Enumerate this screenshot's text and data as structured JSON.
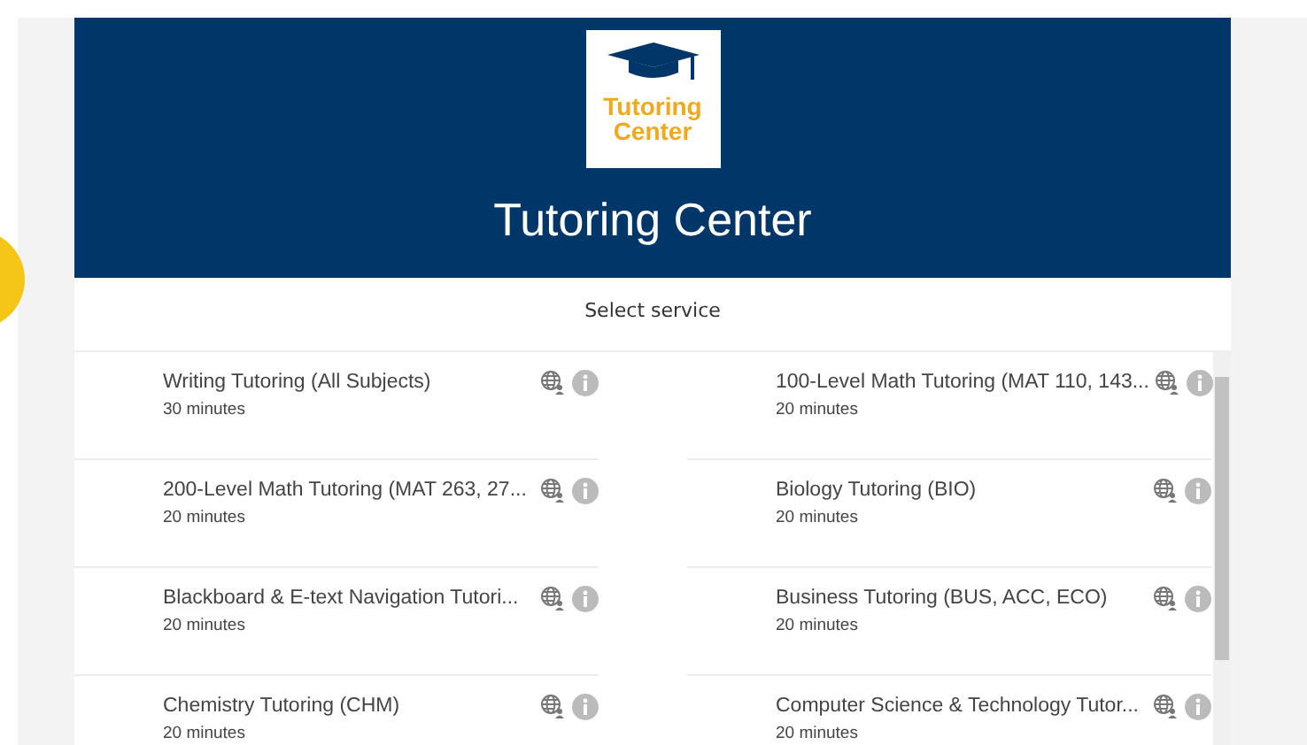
{
  "header": {
    "logo_lines": [
      "Tutoring",
      "Center"
    ],
    "title": "Tutoring Center"
  },
  "section_title": "Select service",
  "services": [
    {
      "name": "Writing Tutoring (All Subjects)",
      "duration": "30 minutes"
    },
    {
      "name": "100-Level Math Tutoring (MAT 110, 143...",
      "duration": "20 minutes"
    },
    {
      "name": "200-Level Math Tutoring (MAT 263, 27...",
      "duration": "20 minutes"
    },
    {
      "name": "Biology Tutoring (BIO)",
      "duration": "20 minutes"
    },
    {
      "name": "Blackboard & E-text Navigation Tutori...",
      "duration": "20 minutes"
    },
    {
      "name": "Business Tutoring (BUS, ACC, ECO)",
      "duration": "20 minutes"
    },
    {
      "name": "Chemistry Tutoring (CHM)",
      "duration": "20 minutes"
    },
    {
      "name": "Computer Science & Technology Tutor...",
      "duration": "20 minutes"
    }
  ]
}
